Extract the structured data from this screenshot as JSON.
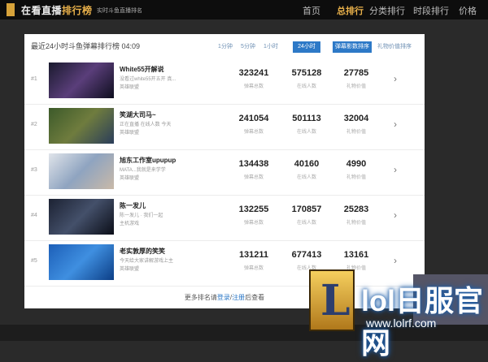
{
  "header": {
    "title_prefix": "在看直播",
    "title_highlight": "排行榜",
    "subtitle": "实时斗鱼直播排名",
    "nav": [
      "首页",
      "总排行",
      "分类排行",
      "时段排行",
      "价格"
    ]
  },
  "ranking": {
    "headline": "最近24小时斗鱼弹幕排行榜 04:09",
    "time_tabs": [
      "1分钟",
      "5分钟",
      "1小时",
      "24小时"
    ],
    "active_tab": "24小时",
    "danmu_button": "弹幕影数排序",
    "gift_link": "礼物价值排序",
    "rows": [
      {
        "rank": "#1",
        "title": "White55开解说",
        "desc": "没看过white55开五开 真...",
        "category": "英雄联盟",
        "danmu": "323241",
        "online": "575128",
        "gift": "27785"
      },
      {
        "rank": "#2",
        "title": "笑湖大司马~",
        "desc": "正在直播 在线人数 今天",
        "category": "英雄联盟",
        "danmu": "241054",
        "online": "501113",
        "gift": "32004"
      },
      {
        "rank": "#3",
        "title": "旭东工作室upupup",
        "desc": "MATA...我就是来学学",
        "category": "英雄联盟",
        "danmu": "134438",
        "online": "40160",
        "gift": "4990"
      },
      {
        "rank": "#4",
        "title": "陈一发儿",
        "desc": "陈一发儿 · 我们一起",
        "category": "主机游戏",
        "danmu": "132255",
        "online": "170857",
        "gift": "25283"
      },
      {
        "rank": "#5",
        "title": "老实敦厚的笑笑",
        "desc": "今天给大家讲解游戏上主",
        "category": "英雄联盟",
        "danmu": "131211",
        "online": "677413",
        "gift": "13161"
      }
    ],
    "metric_labels": {
      "danmu": "弹幕总数",
      "online": "在线人数",
      "gift": "礼物价值"
    },
    "more_prefix": "更多排名请",
    "more_login": "登录",
    "more_sep": "/",
    "more_register": "注册",
    "more_suffix": "后查看"
  },
  "watermark": {
    "title": "lol日服官网",
    "url": "www.lolrf.com",
    "logo_letter": "L"
  },
  "colors": {
    "accent": "#2d79c7",
    "brand": "#e8b04a"
  }
}
